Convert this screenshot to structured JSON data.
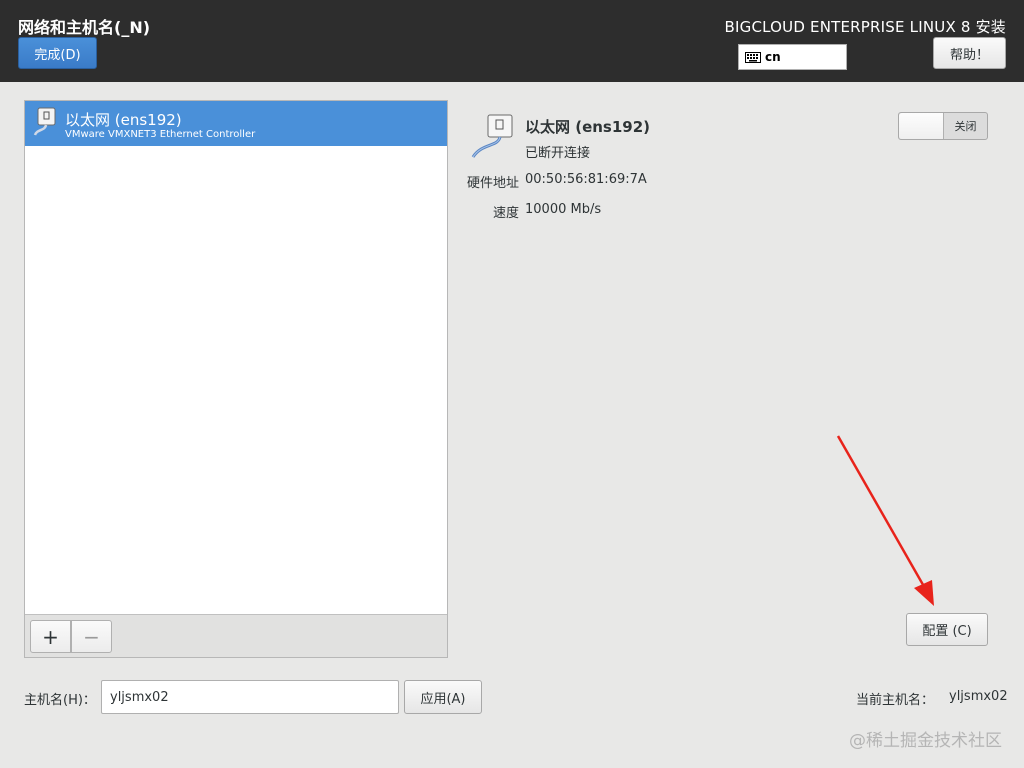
{
  "header": {
    "spoke_title": "网络和主机名(_N)",
    "done_label": "完成(D)",
    "product_title": "BIGCLOUD ENTERPRISE LINUX 8 安装",
    "keyboard_layout": "cn",
    "help_label": "帮助！"
  },
  "device_list": {
    "items": [
      {
        "name": "以太网 (ens192)",
        "description": "VMware VMXNET3 Ethernet Controller",
        "selected": true
      }
    ],
    "add_label": "+",
    "remove_label": "−"
  },
  "detail": {
    "name": "以太网 (ens192)",
    "status": "已断开连接",
    "hardware_address_label": "硬件地址",
    "hardware_address": "00:50:56:81:69:7A",
    "speed_label": "速度",
    "speed": "10000 Mb/s",
    "toggle_label": "关闭",
    "configure_label": "配置 (C)"
  },
  "hostname": {
    "label": "主机名(H)：",
    "value": "yljsmx02",
    "apply_label": "应用(A)",
    "current_label": "当前主机名：",
    "current_value": "yljsmx02"
  },
  "watermark": "@稀土掘金技术社区",
  "colors": {
    "header_bg": "#2d2d2d",
    "accent": "#4a90d9",
    "annotation_arrow": "#e8231b"
  }
}
